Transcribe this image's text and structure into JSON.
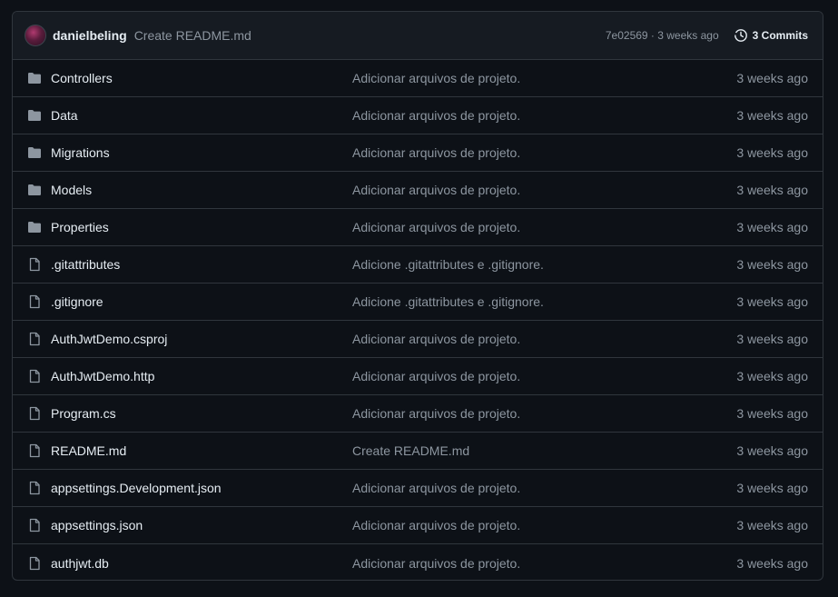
{
  "header": {
    "author": "danielbeling",
    "message": "Create README.md",
    "hash_age": "7e02569 · 3 weeks ago",
    "commits_label": "3 Commits"
  },
  "files": [
    {
      "type": "folder",
      "name": "Controllers",
      "message": "Adicionar arquivos de projeto.",
      "age": "3 weeks ago"
    },
    {
      "type": "folder",
      "name": "Data",
      "message": "Adicionar arquivos de projeto.",
      "age": "3 weeks ago"
    },
    {
      "type": "folder",
      "name": "Migrations",
      "message": "Adicionar arquivos de projeto.",
      "age": "3 weeks ago"
    },
    {
      "type": "folder",
      "name": "Models",
      "message": "Adicionar arquivos de projeto.",
      "age": "3 weeks ago"
    },
    {
      "type": "folder",
      "name": "Properties",
      "message": "Adicionar arquivos de projeto.",
      "age": "3 weeks ago"
    },
    {
      "type": "file",
      "name": ".gitattributes",
      "message": "Adicione .gitattributes e .gitignore.",
      "age": "3 weeks ago"
    },
    {
      "type": "file",
      "name": ".gitignore",
      "message": "Adicione .gitattributes e .gitignore.",
      "age": "3 weeks ago"
    },
    {
      "type": "file",
      "name": "AuthJwtDemo.csproj",
      "message": "Adicionar arquivos de projeto.",
      "age": "3 weeks ago"
    },
    {
      "type": "file",
      "name": "AuthJwtDemo.http",
      "message": "Adicionar arquivos de projeto.",
      "age": "3 weeks ago"
    },
    {
      "type": "file",
      "name": "Program.cs",
      "message": "Adicionar arquivos de projeto.",
      "age": "3 weeks ago"
    },
    {
      "type": "file",
      "name": "README.md",
      "message": "Create README.md",
      "age": "3 weeks ago"
    },
    {
      "type": "file",
      "name": "appsettings.Development.json",
      "message": "Adicionar arquivos de projeto.",
      "age": "3 weeks ago"
    },
    {
      "type": "file",
      "name": "appsettings.json",
      "message": "Adicionar arquivos de projeto.",
      "age": "3 weeks ago"
    },
    {
      "type": "file",
      "name": "authjwt.db",
      "message": "Adicionar arquivos de projeto.",
      "age": "3 weeks ago"
    }
  ],
  "colors": {
    "background": "#0d1117",
    "header_bg": "#161b22",
    "border": "#30363d",
    "text": "#e6edf3",
    "muted": "#8d96a0"
  }
}
